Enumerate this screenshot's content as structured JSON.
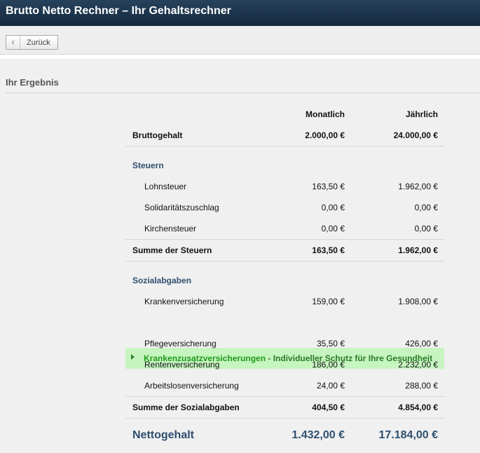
{
  "header": {
    "title": "Brutto Netto Rechner – Ihr Gehaltsrechner"
  },
  "toolbar": {
    "back_label": "Zurück",
    "back_icon": "chevron-left-icon"
  },
  "result": {
    "heading": "Ihr Ergebnis"
  },
  "table": {
    "col_monthly": "Monatlich",
    "col_yearly": "Jährlich",
    "gross": {
      "label": "Bruttogehalt",
      "monthly": "2.000,00 €",
      "yearly": "24.000,00 €"
    },
    "taxes": {
      "title": "Steuern",
      "items": [
        {
          "label": "Lohnsteuer",
          "monthly": "163,50 €",
          "yearly": "1.962,00 €"
        },
        {
          "label": "Solidaritätszuschlag",
          "monthly": "0,00 €",
          "yearly": "0,00 €"
        },
        {
          "label": "Kirchensteuer",
          "monthly": "0,00 €",
          "yearly": "0,00 €"
        }
      ],
      "sum": {
        "label": "Summe der Steuern",
        "monthly": "163,50 €",
        "yearly": "1.962,00 €"
      }
    },
    "social": {
      "title": "Sozialabgaben",
      "items": [
        {
          "label": "Krankenversicherung",
          "monthly": "159,00 €",
          "yearly": "1.908,00 €"
        },
        {
          "label": "Pflegeversicherung",
          "monthly": "35,50 €",
          "yearly": "426,00 €"
        },
        {
          "label": "Rentenversicherung",
          "monthly": "186,00 €",
          "yearly": "2.232,00 €"
        },
        {
          "label": "Arbeitslosenversicherung",
          "monthly": "24,00 €",
          "yearly": "288,00 €"
        }
      ],
      "sum": {
        "label": "Summe der Sozialabgaben",
        "monthly": "404,50 €",
        "yearly": "4.854,00 €"
      }
    },
    "promo": {
      "link": "Krankenzusatzversicherungen",
      "text": " - Individueller Schutz für Ihre Gesundheit",
      "color": "#c6f5c0"
    },
    "net": {
      "label": "Nettogehalt",
      "monthly": "1.432,00 €",
      "yearly": "17.184,00 €"
    }
  },
  "colors": {
    "header_bg": "#1b3249",
    "section_text": "#2e4f6f",
    "promo_text": "#2a7a25"
  }
}
